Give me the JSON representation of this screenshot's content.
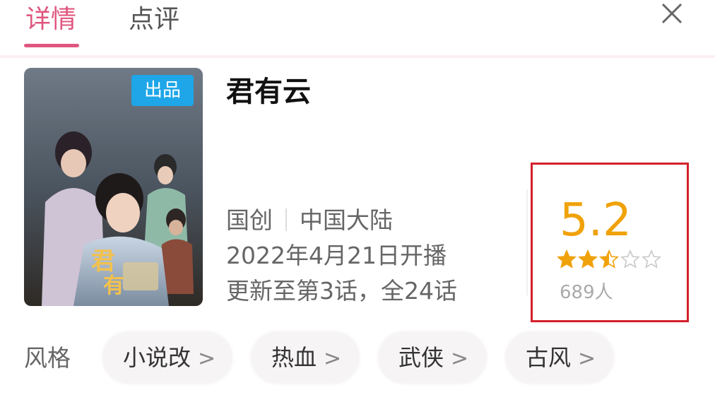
{
  "tabs": [
    {
      "label": "详情",
      "active": true
    },
    {
      "label": "点评",
      "active": false
    }
  ],
  "colors": {
    "accent": "#e0567f",
    "score": "#f0a20a",
    "badge": "#1ea6e8",
    "highlight_box": "#d4202a"
  },
  "icons": {
    "close": "close-icon",
    "star_full": "star-filled-icon",
    "star_half": "star-half-icon",
    "star_empty": "star-empty-icon",
    "chevron": "chevron-right-icon"
  },
  "anime": {
    "title": "君有云",
    "badge": "出品",
    "origin": "国创",
    "region": "中国大陆",
    "premiere": "2022年4月21日开播",
    "episodes": "更新至第3话，全24话"
  },
  "rating": {
    "score": "5.2",
    "stars": 2.5,
    "max_stars": 5,
    "count": "689人"
  },
  "styles": {
    "label": "风格",
    "tags": [
      {
        "label": "小说改",
        "chevron": ">"
      },
      {
        "label": "热血",
        "chevron": ">"
      },
      {
        "label": "武侠",
        "chevron": ">"
      },
      {
        "label": "古风",
        "chevron": ">"
      }
    ]
  }
}
